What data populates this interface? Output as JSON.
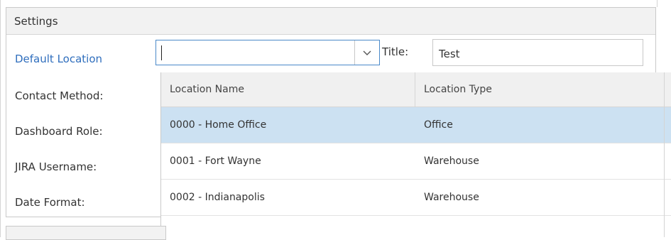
{
  "panel": {
    "header": "Settings",
    "labels": {
      "default_location": "Default Location",
      "contact_method": "Contact Method:",
      "dashboard_role": "Dashboard Role:",
      "jira_username": "JIRA Username:",
      "date_format": "Date Format:"
    },
    "default_location_value": "",
    "title_label": "Title:",
    "title_value": "Test"
  },
  "dropdown": {
    "columns": [
      "Location Name",
      "Location Type"
    ],
    "rows": [
      {
        "name": "0000 - Home Office",
        "type": "Office",
        "selected": true
      },
      {
        "name": "0001 - Fort Wayne",
        "type": "Warehouse",
        "selected": false
      },
      {
        "name": "0002 - Indianapolis",
        "type": "Warehouse",
        "selected": false
      }
    ]
  },
  "colors": {
    "link": "#2f6ebd",
    "selected_row": "#cce1f2",
    "focus_border": "#4a89c9"
  },
  "icons": {
    "dropdown_arrow": "chevron-down-icon"
  }
}
